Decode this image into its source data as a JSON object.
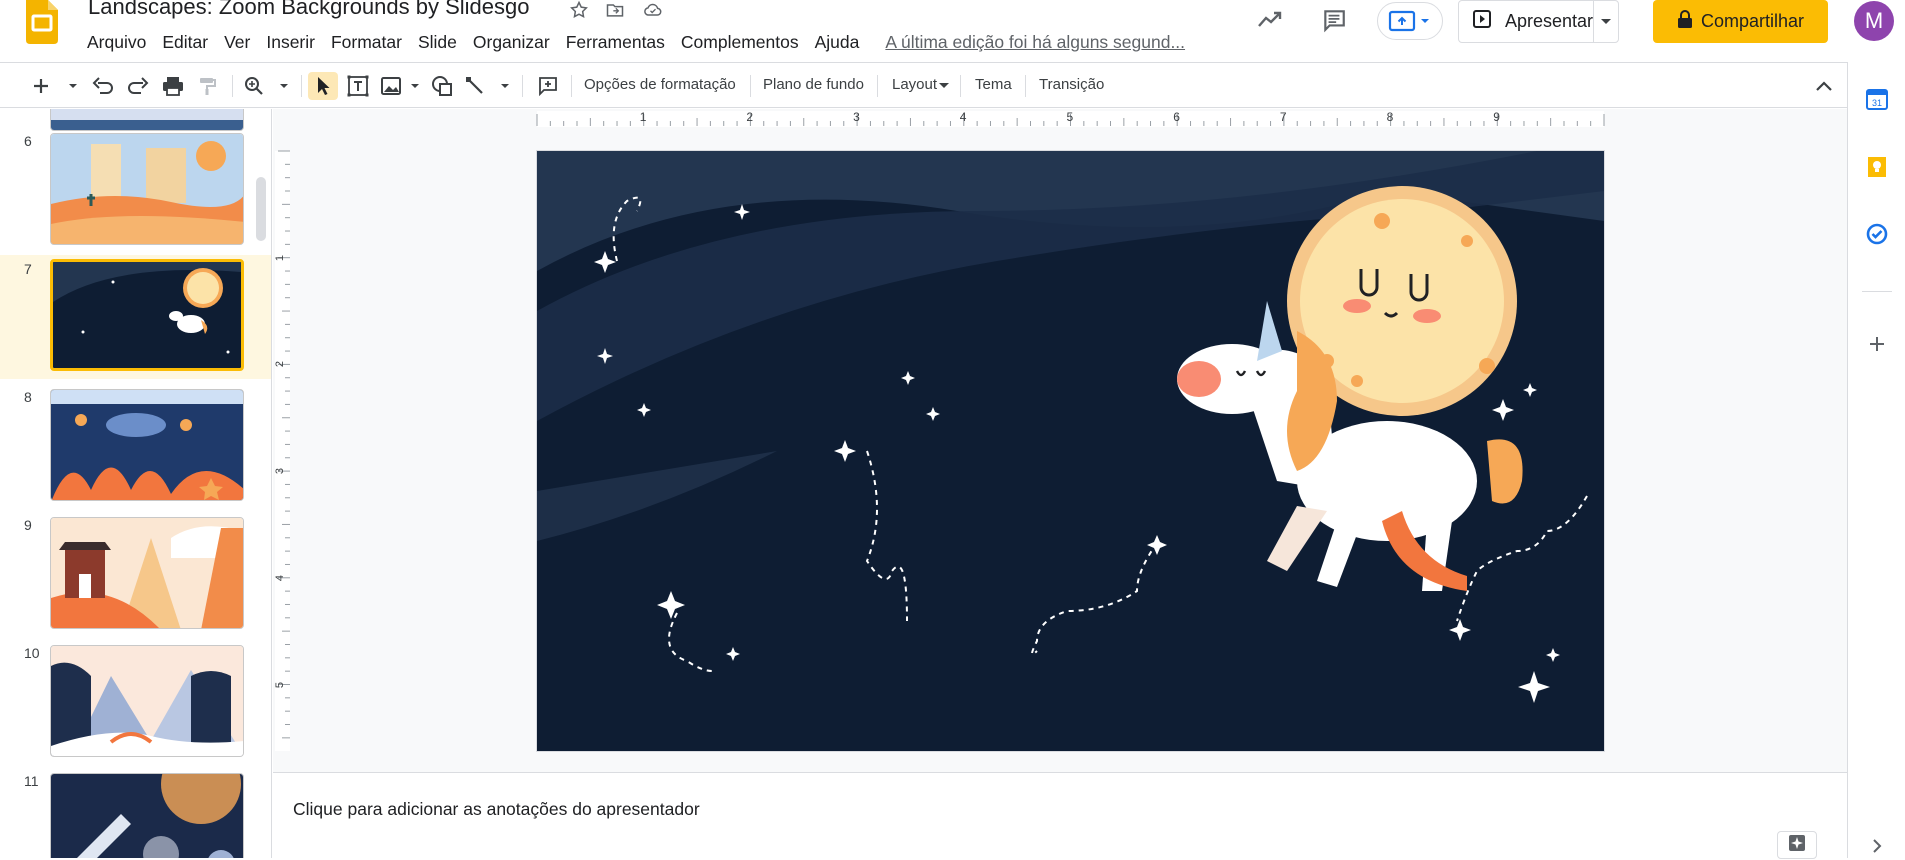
{
  "header": {
    "title": "Landscapes: Zoom Backgrounds by Slidesgo",
    "present_label": "Apresentar",
    "share_label": "Compartilhar",
    "avatar_initial": "M"
  },
  "menu": [
    "Arquivo",
    "Editar",
    "Ver",
    "Inserir",
    "Formatar",
    "Slide",
    "Organizar",
    "Ferramentas",
    "Complementos",
    "Ajuda"
  ],
  "last_edit": "A última edição foi há alguns segund...",
  "toolbar": {
    "format_options": "Opções de formatação",
    "background": "Plano de fundo",
    "layout": "Layout",
    "theme": "Tema",
    "transition": "Transição"
  },
  "filmstrip": {
    "slides": [
      {
        "number": "6"
      },
      {
        "number": "7"
      },
      {
        "number": "8"
      },
      {
        "number": "9"
      },
      {
        "number": "10"
      },
      {
        "number": "11"
      }
    ],
    "selected": "7"
  },
  "ruler": {
    "h_labels": [
      "1",
      "2",
      "3",
      "4",
      "5",
      "6",
      "7",
      "8",
      "9"
    ],
    "v_labels": [
      "1",
      "2",
      "3",
      "4",
      "5"
    ]
  },
  "notes": {
    "placeholder": "Clique para adicionar as anotações do apresentador"
  },
  "colors": {
    "accent": "#fbbc04",
    "slide_bg": "#0e1d33",
    "avatar": "#8e44ad"
  }
}
